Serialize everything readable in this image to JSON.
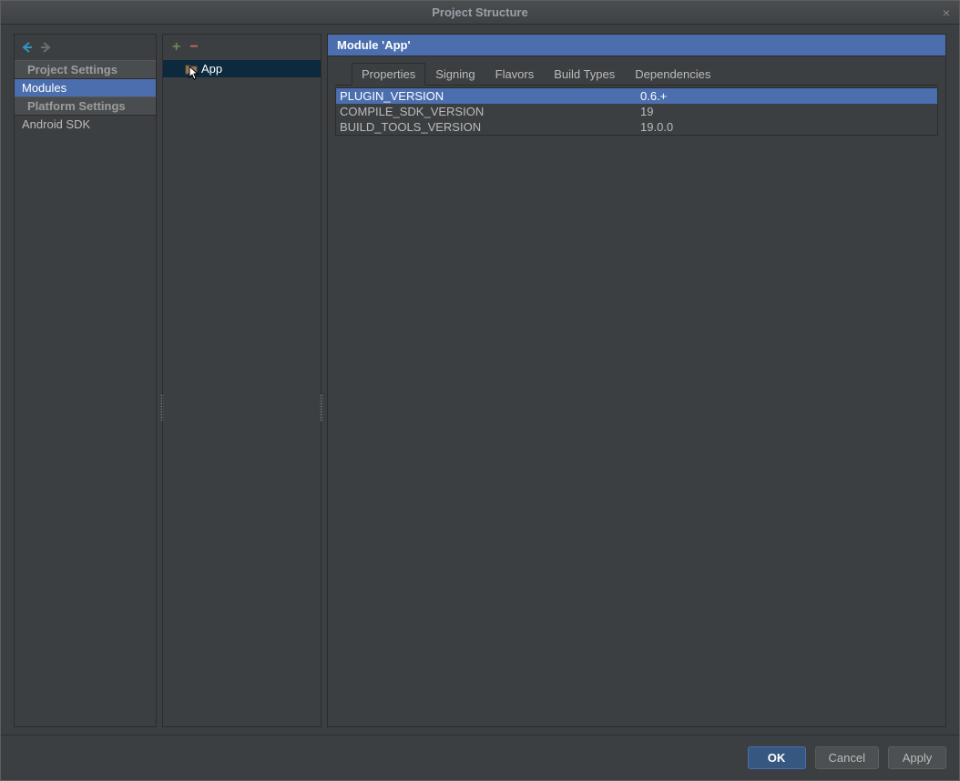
{
  "window": {
    "title": "Project Structure"
  },
  "sidebar": {
    "sections": [
      {
        "label": "Project Settings"
      },
      {
        "label": "Platform Settings"
      }
    ],
    "items": {
      "modules": "Modules",
      "android_sdk": "Android SDK"
    }
  },
  "modules": {
    "items": [
      {
        "label": "App"
      }
    ]
  },
  "details": {
    "header": "Module 'App'",
    "tabs": [
      {
        "label": "Properties"
      },
      {
        "label": "Signing"
      },
      {
        "label": "Flavors"
      },
      {
        "label": "Build Types"
      },
      {
        "label": "Dependencies"
      }
    ],
    "properties": [
      {
        "key": "PLUGIN_VERSION",
        "value": "0.6.+"
      },
      {
        "key": "COMPILE_SDK_VERSION",
        "value": "19"
      },
      {
        "key": "BUILD_TOOLS_VERSION",
        "value": "19.0.0"
      }
    ]
  },
  "footer": {
    "ok": "OK",
    "cancel": "Cancel",
    "apply": "Apply"
  }
}
